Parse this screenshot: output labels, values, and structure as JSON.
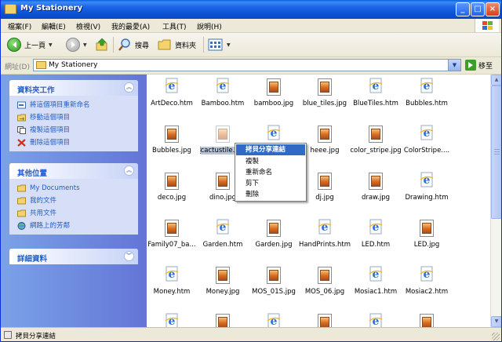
{
  "window": {
    "title": "My Stationery"
  },
  "titlebar_buttons": [
    "_",
    "□",
    "×"
  ],
  "menu": [
    "檔案(F)",
    "編輯(E)",
    "檢視(V)",
    "我的最愛(A)",
    "工具(T)",
    "說明(H)"
  ],
  "toolbar": {
    "back": "上一頁",
    "search": "搜尋",
    "folders": "資料夾"
  },
  "address": {
    "label": "網址(D)",
    "value": "My Stationery",
    "go": "移至"
  },
  "panels": {
    "tasks": {
      "title": "資料夾工作",
      "items": [
        "將這個項目重新命名",
        "移動這個項目",
        "複製這個項目",
        "刪除這個項目"
      ]
    },
    "places": {
      "title": "其他位置",
      "items": [
        "My Documents",
        "我的文件",
        "共用文件",
        "網路上的芳鄰"
      ]
    },
    "details": {
      "title": "詳細資料"
    }
  },
  "files": [
    {
      "name": "ArtDeco.htm",
      "type": "htm"
    },
    {
      "name": "Bamboo.htm",
      "type": "htm"
    },
    {
      "name": "bamboo.jpg",
      "type": "jpg"
    },
    {
      "name": "blue_tiles.jpg",
      "type": "jpg"
    },
    {
      "name": "BlueTiles.htm",
      "type": "htm"
    },
    {
      "name": "Bubbles.htm",
      "type": "htm"
    },
    {
      "name": "Bubbles.jpg",
      "type": "jpg"
    },
    {
      "name": "cactustile.jpg",
      "type": "jpg"
    },
    {
      "name": "",
      "type": "htm"
    },
    {
      "name": "heee.jpg",
      "type": "jpg"
    },
    {
      "name": "color_stripe.jpg",
      "type": "jpg"
    },
    {
      "name": "ColorStripe....",
      "type": "htm"
    },
    {
      "name": "deco.jpg",
      "type": "jpg"
    },
    {
      "name": "dino.jpg",
      "type": "jpg"
    },
    {
      "name": "",
      "type": "htm"
    },
    {
      "name": "dj.jpg",
      "type": "jpg"
    },
    {
      "name": "draw.jpg",
      "type": "jpg"
    },
    {
      "name": "Drawing.htm",
      "type": "htm"
    },
    {
      "name": "Family07_ba...",
      "type": "jpg"
    },
    {
      "name": "Garden.htm",
      "type": "htm"
    },
    {
      "name": "Garden.jpg",
      "type": "jpg"
    },
    {
      "name": "HandPrints.htm",
      "type": "htm"
    },
    {
      "name": "LED.htm",
      "type": "htm"
    },
    {
      "name": "LED.jpg",
      "type": "jpg"
    },
    {
      "name": "Money.htm",
      "type": "htm"
    },
    {
      "name": "Money.jpg",
      "type": "jpg"
    },
    {
      "name": "MOS_01S.jpg",
      "type": "jpg"
    },
    {
      "name": "MOS_06.jpg",
      "type": "jpg"
    },
    {
      "name": "Mosiac1.htm",
      "type": "htm"
    },
    {
      "name": "Mosiac2.htm",
      "type": "htm"
    },
    {
      "name": "",
      "type": "htm"
    },
    {
      "name": "",
      "type": "jpg"
    },
    {
      "name": "",
      "type": "htm"
    },
    {
      "name": "",
      "type": "jpg"
    },
    {
      "name": "",
      "type": "htm"
    },
    {
      "name": "",
      "type": "jpg"
    }
  ],
  "context_menu": [
    "拷貝分享連結",
    "複製",
    "重新命名",
    "剪下",
    "刪除"
  ],
  "status": {
    "text": "拷貝分享連結"
  },
  "colors": {
    "titlebar": "#0b47c3",
    "task_link": "#215dc6",
    "menu_highlight": "#316ac5"
  }
}
